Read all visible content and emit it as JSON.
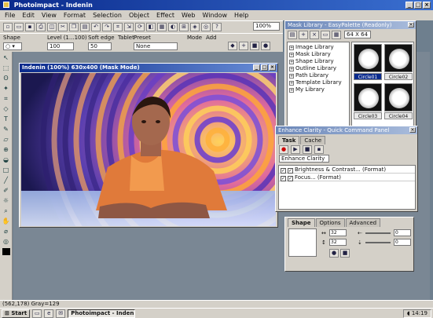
{
  "app": {
    "title": "Photoimpact - Indenin"
  },
  "menu": [
    "File",
    "Edit",
    "View",
    "Format",
    "Selection",
    "Object",
    "Effect",
    "Web",
    "Window",
    "Help"
  ],
  "toolbar": {
    "zoom": "100%"
  },
  "attributes": {
    "shape_label": "Shape",
    "level_label": "Level (1...100)",
    "level_value": "100",
    "soft_edge_label": "Soft edge",
    "soft_edge_value": "50",
    "tablet_label": "Tablet",
    "preset_label": "Preset",
    "preset_value": "None",
    "mode_label": "Mode",
    "add_label": "Add"
  },
  "document": {
    "title": "Indenin (100%) 630x400 (Mask Mode)"
  },
  "library": {
    "title": "Mask Library - EasyPalette (Readonly)",
    "size_select": "64 X 64",
    "tree": [
      "Image Library",
      "Mask Library",
      "Shape Library",
      "Outline Library",
      "Path Library",
      "Template Library",
      "My Library"
    ],
    "thumbs": [
      "Circle01",
      "Circle02",
      "Circle03",
      "Circle04"
    ]
  },
  "quick_command": {
    "title": "Enhance Clarity - Quick Command Panel",
    "tabs": [
      "Task",
      "Cache"
    ],
    "select": "Enhance Clarity",
    "rows": [
      "Brightness & Contrast... (Format)",
      "Focus... (Format)"
    ]
  },
  "shape_panel": {
    "tabs": [
      "Shape",
      "Options",
      "Advanced"
    ],
    "values": [
      "32",
      "32",
      "0",
      "0"
    ]
  },
  "status": {
    "text": "(562,178) Gray=129"
  },
  "taskbar": {
    "start": "Start",
    "task": "Photoimpact - Indenin",
    "time": "14:19"
  },
  "colors": {
    "titlebar": "#0a2a8c",
    "chrome": "#d4d0c8",
    "workspace": "#7a8794"
  }
}
